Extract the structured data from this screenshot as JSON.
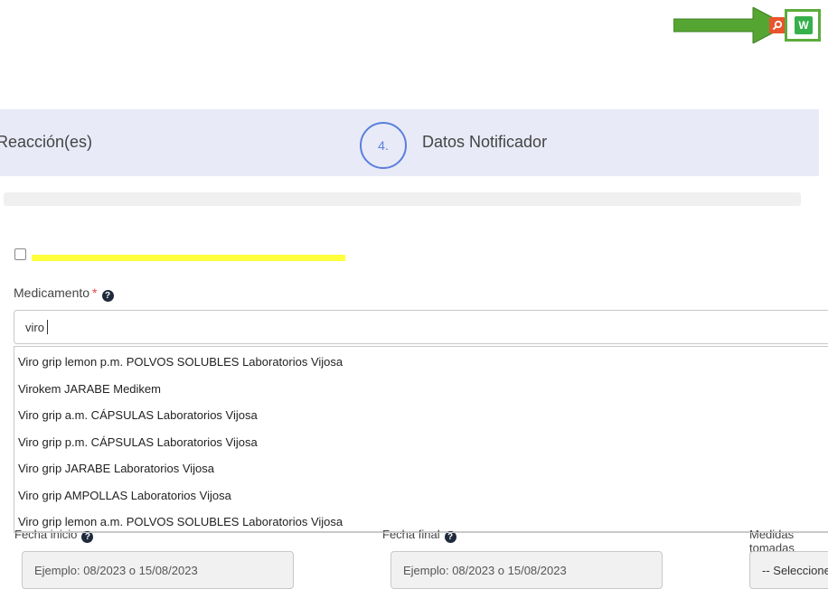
{
  "toolbar": {
    "search_icon": "search-icon",
    "w_label": "W",
    "colors": {
      "arrow": "#55a532",
      "search_button": "#e8542d",
      "w_icon": "#35b04b"
    }
  },
  "steps": {
    "previous_label": "Reacción(es)",
    "current_number": "4.",
    "current_label": "Datos Notificador",
    "accent_color": "#5b7fdb"
  },
  "form": {
    "medicamento": {
      "label": "Medicamento",
      "required_mark": "*",
      "help_icon": "?",
      "value": "viro"
    },
    "suggestions": [
      "Viro grip lemon p.m. POLVOS SOLUBLES Laboratorios Vijosa",
      "Virokem JARABE Medikem",
      "Viro grip a.m. CÁPSULAS Laboratorios Vijosa",
      "Viro grip p.m. CÁPSULAS Laboratorios Vijosa",
      "Viro grip JARABE Laboratorios Vijosa",
      "Viro grip AMPOLLAS Laboratorios Vijosa",
      "Viro grip lemon a.m. POLVOS SOLUBLES Laboratorios Vijosa"
    ],
    "fecha_inicio": {
      "label": "Fecha inicio",
      "placeholder": "Ejemplo: 08/2023 o 15/08/2023"
    },
    "fecha_final": {
      "label": "Fecha final",
      "placeholder": "Ejemplo: 08/2023 o 15/08/2023"
    },
    "medidas": {
      "label": "Medidas tomadas",
      "selected": "-- Seleccione --"
    }
  }
}
